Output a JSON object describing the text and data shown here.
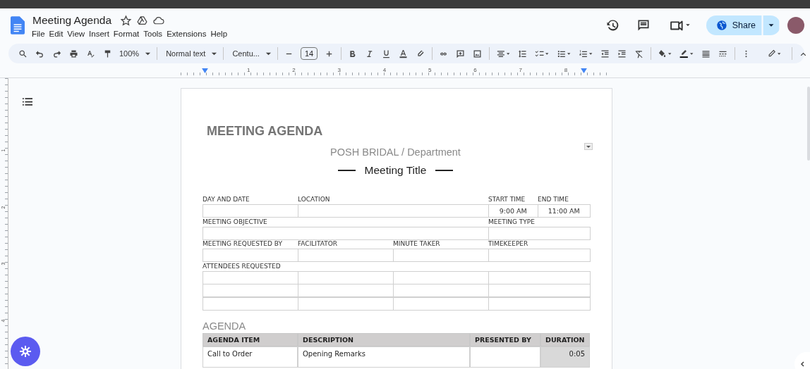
{
  "window": {
    "title": "Meeting Agenda"
  },
  "menu": [
    "File",
    "Edit",
    "View",
    "Insert",
    "Format",
    "Tools",
    "Extensions",
    "Help"
  ],
  "share_button": "Share",
  "toolbar": {
    "zoom": "100%",
    "style": "Normal text",
    "font": "Centu...",
    "font_size": "14"
  },
  "ruler": {
    "h_numbers": [
      "1",
      "2",
      "3",
      "4",
      "5",
      "6",
      "7",
      "8"
    ],
    "v_numbers": [
      "1",
      "2",
      "3",
      "4"
    ]
  },
  "document": {
    "heading": "MEETING AGENDA",
    "department": "POSH BRIDAL / Department",
    "meeting_title": "Meeting Title",
    "details": [
      {
        "fields": [
          {
            "label": "DAY AND DATE"
          },
          {
            "label": "LOCATION"
          },
          {
            "label": "START TIME",
            "value": "9:00 AM"
          },
          {
            "label": "END TIME",
            "value": "11:00 AM"
          }
        ]
      },
      {
        "fields": [
          {
            "label": "MEETING OBJECTIVE"
          },
          {
            "label": "MEETING TYPE"
          }
        ]
      },
      {
        "fields": [
          {
            "label": "MEETING REQUESTED BY"
          },
          {
            "label": "FACILITATOR"
          },
          {
            "label": "MINUTE TAKER"
          },
          {
            "label": "TIMEKEEPER"
          }
        ]
      }
    ],
    "attendees_label": "ATTENDEES REQUESTED",
    "agenda": {
      "title": "AGENDA",
      "columns": [
        "AGENDA ITEM",
        "DESCRIPTION",
        "PRESENTED BY",
        "DURATION"
      ],
      "rows": [
        [
          "Call to Order",
          "Opening Remarks",
          null,
          "0:05"
        ]
      ]
    }
  }
}
